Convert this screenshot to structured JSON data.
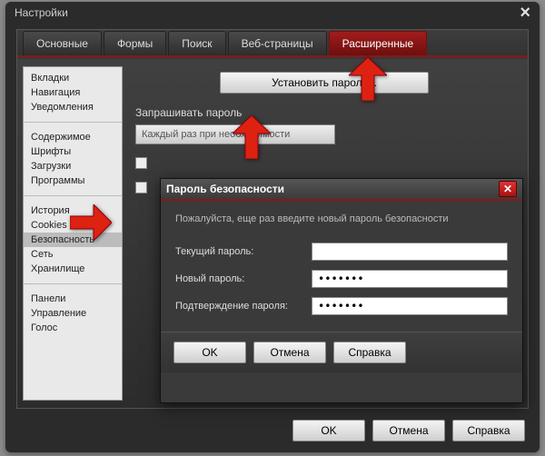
{
  "window": {
    "title": "Настройки"
  },
  "tabs": [
    "Основные",
    "Формы",
    "Поиск",
    "Веб-страницы",
    "Расширенные"
  ],
  "active_tab": 4,
  "sidebar": {
    "groups": [
      [
        "Вкладки",
        "Навигация",
        "Уведомления"
      ],
      [
        "Содержимое",
        "Шрифты",
        "Загрузки",
        "Программы"
      ],
      [
        "История",
        "Cookies",
        "Безопасность",
        "Сеть",
        "Хранилище"
      ],
      [
        "Панели",
        "Управление",
        "Голос"
      ]
    ],
    "selected": "Безопасность"
  },
  "main": {
    "set_password_btn": "Установить пароль...",
    "ask_password_label": "Запрашивать пароль",
    "ask_password_value": "Каждый раз при необходимости"
  },
  "dialog": {
    "title": "Пароль безопасности",
    "message": "Пожалуйста, еще раз введите новый пароль безопасности",
    "current_label": "Текущий пароль:",
    "current_value": "",
    "new_label": "Новый пароль:",
    "new_value": "•••••••",
    "confirm_label": "Подтверждение пароля:",
    "confirm_value": "•••••••",
    "ok": "OK",
    "cancel": "Отмена",
    "help": "Справка"
  },
  "footer": {
    "ok": "OK",
    "cancel": "Отмена",
    "help": "Справка"
  }
}
